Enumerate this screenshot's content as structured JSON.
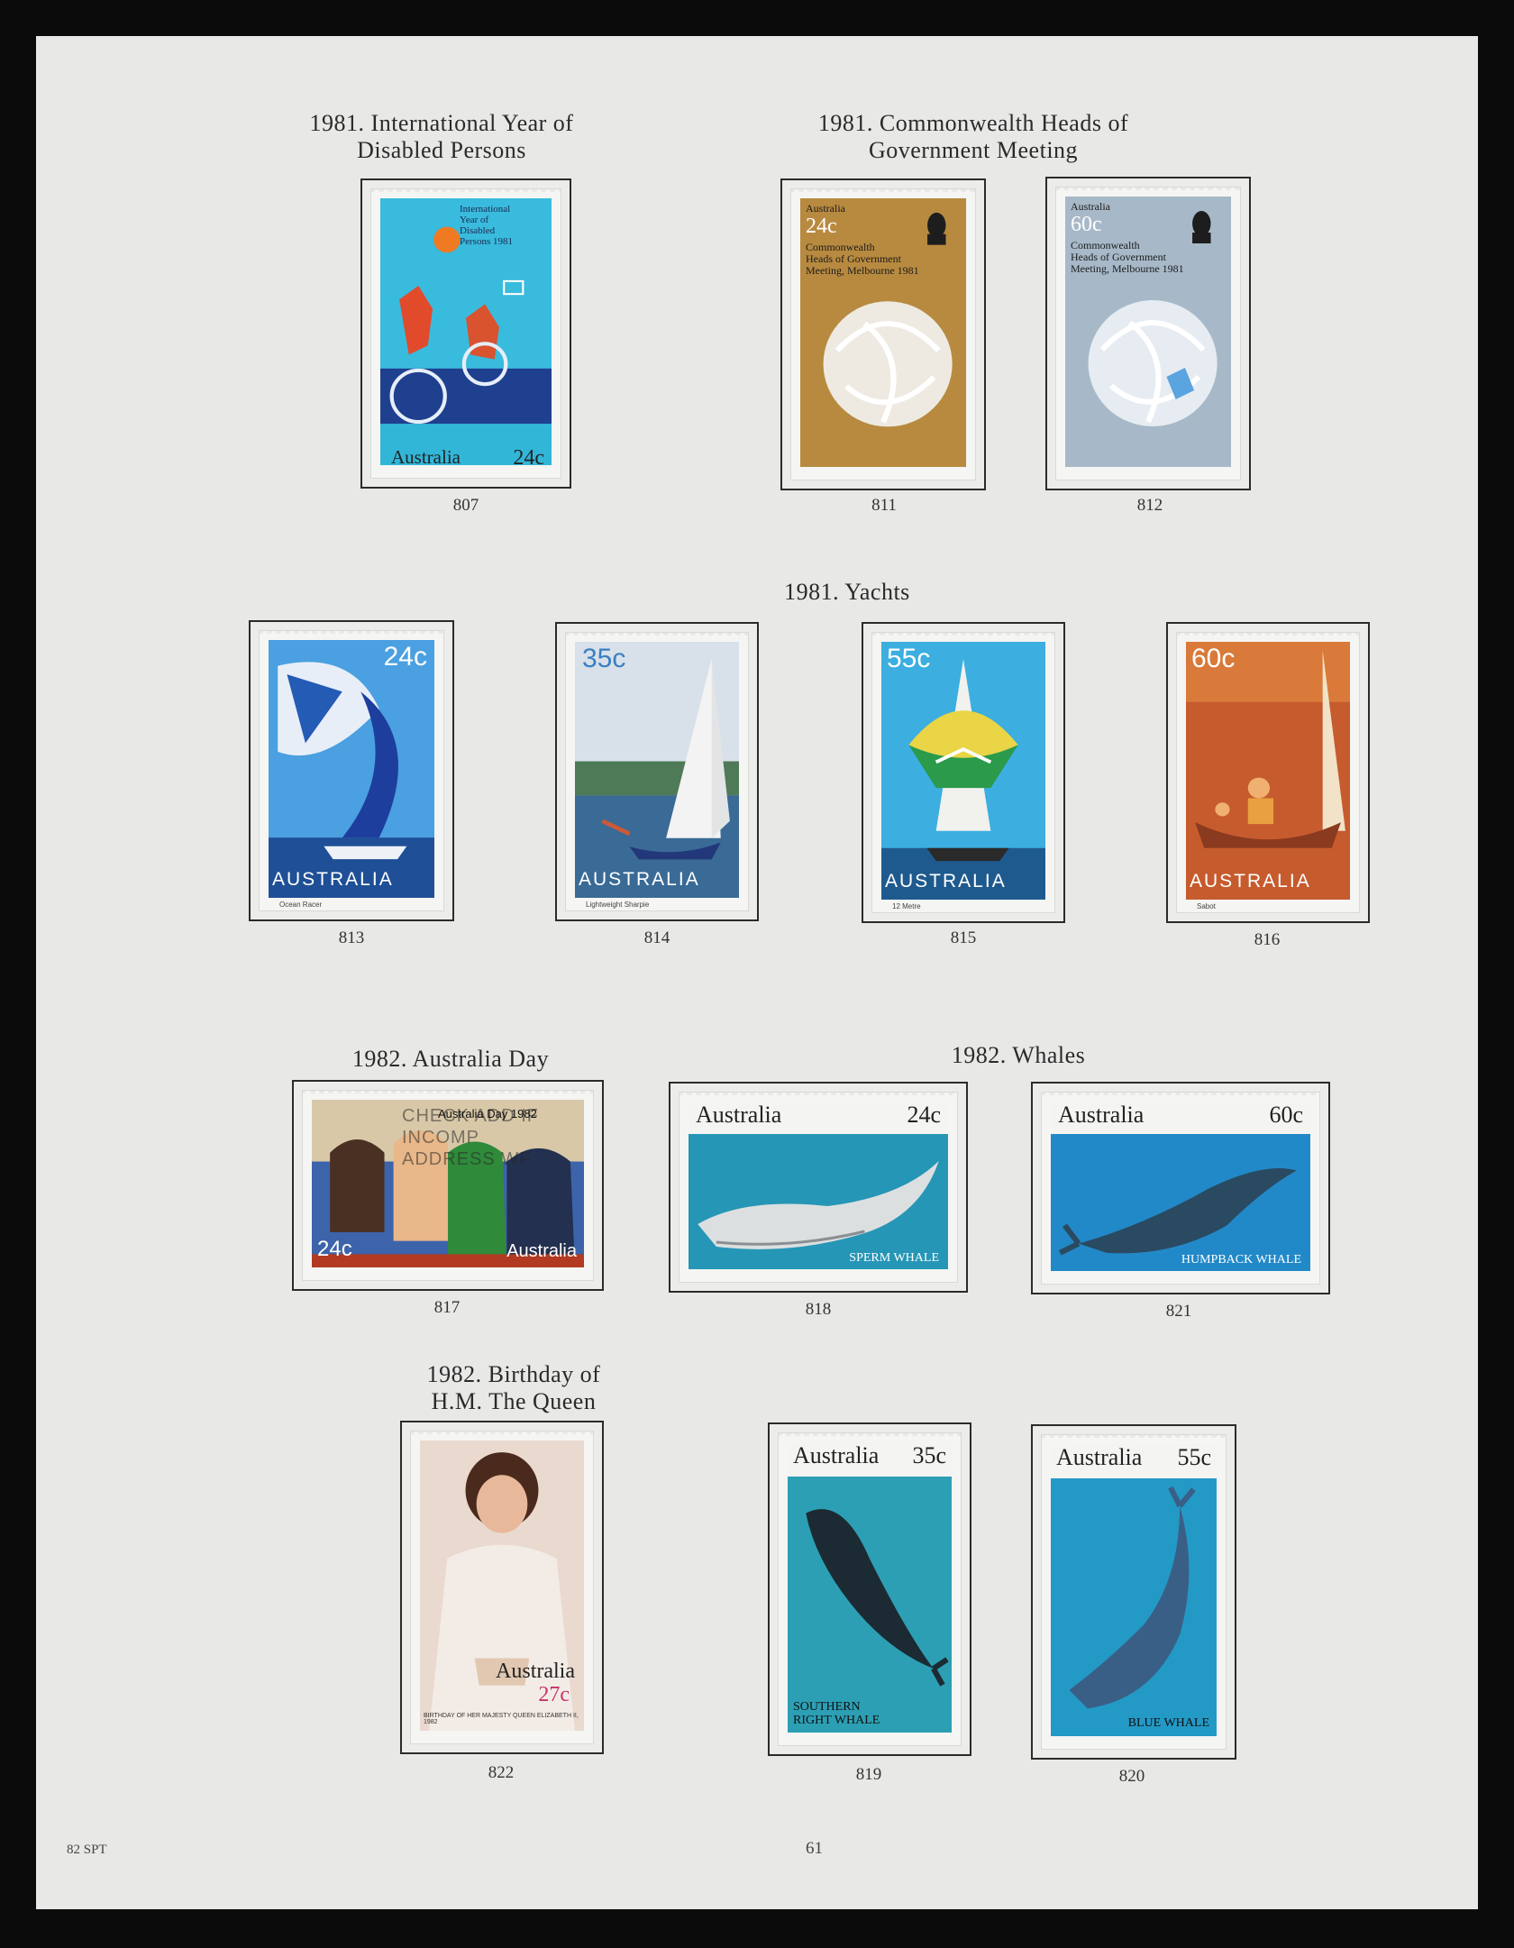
{
  "sections": {
    "disabled": {
      "line1": "1981.  International Year of",
      "line2": "Disabled Persons"
    },
    "chogm": {
      "line1": "1981.  Commonwealth Heads of",
      "line2": "Government Meeting"
    },
    "yachts": {
      "title": "1981.  Yachts"
    },
    "australia_day": {
      "title": "1982.  Australia Day"
    },
    "whales": {
      "title": "1982.  Whales"
    },
    "queen": {
      "line1": "1982.  Birthday of",
      "line2": "H.M. The Queen"
    }
  },
  "stamps": {
    "s807": {
      "number": "807",
      "country": "Australia",
      "value": "24c",
      "text1": "International",
      "text2": "Year of",
      "text3": "Disabled",
      "text4": "Persons 1981"
    },
    "s811": {
      "number": "811",
      "country": "Australia",
      "value": "24c",
      "text1": "Commonwealth",
      "text2": "Heads of Government",
      "text3": "Meeting, Melbourne 1981"
    },
    "s812": {
      "number": "812",
      "country": "Australia",
      "value": "60c",
      "text1": "Commonwealth",
      "text2": "Heads of Government",
      "text3": "Meeting, Melbourne 1981"
    },
    "s813": {
      "number": "813",
      "country": "AUSTRALIA",
      "value": "24c",
      "caption": "Ocean Racer"
    },
    "s814": {
      "number": "814",
      "country": "AUSTRALIA",
      "value": "35c",
      "caption": "Lightweight Sharpie"
    },
    "s815": {
      "number": "815",
      "country": "AUSTRALIA",
      "value": "55c",
      "caption": "12 Metre"
    },
    "s816": {
      "number": "816",
      "country": "AUSTRALIA",
      "value": "60c",
      "caption": "Sabot"
    },
    "s817": {
      "number": "817",
      "country": "Australia",
      "value": "24c",
      "title": "Australia Day 1982",
      "postmark": "CHECK ADD IF INCOMP ADDRESS WF"
    },
    "s818": {
      "number": "818",
      "country": "Australia",
      "value": "24c",
      "caption": "SPERM WHALE"
    },
    "s821": {
      "number": "821",
      "country": "Australia",
      "value": "60c",
      "caption": "HUMPBACK WHALE"
    },
    "s822": {
      "number": "822",
      "country": "Australia",
      "value": "27c",
      "caption": "BIRTHDAY OF HER MAJESTY QUEEN ELIZABETH II, 1982"
    },
    "s819": {
      "number": "819",
      "country": "Australia",
      "value": "35c",
      "caption1": "SOUTHERN",
      "caption2": "RIGHT WHALE"
    },
    "s820": {
      "number": "820",
      "country": "Australia",
      "value": "55c",
      "caption": "BLUE WHALE"
    }
  },
  "footer": {
    "left": "82 SPT",
    "page_number": "61"
  },
  "colors": {
    "page": "#e8e9e7",
    "border": "#0b0b0b",
    "mount_line": "#2b2b2b"
  }
}
